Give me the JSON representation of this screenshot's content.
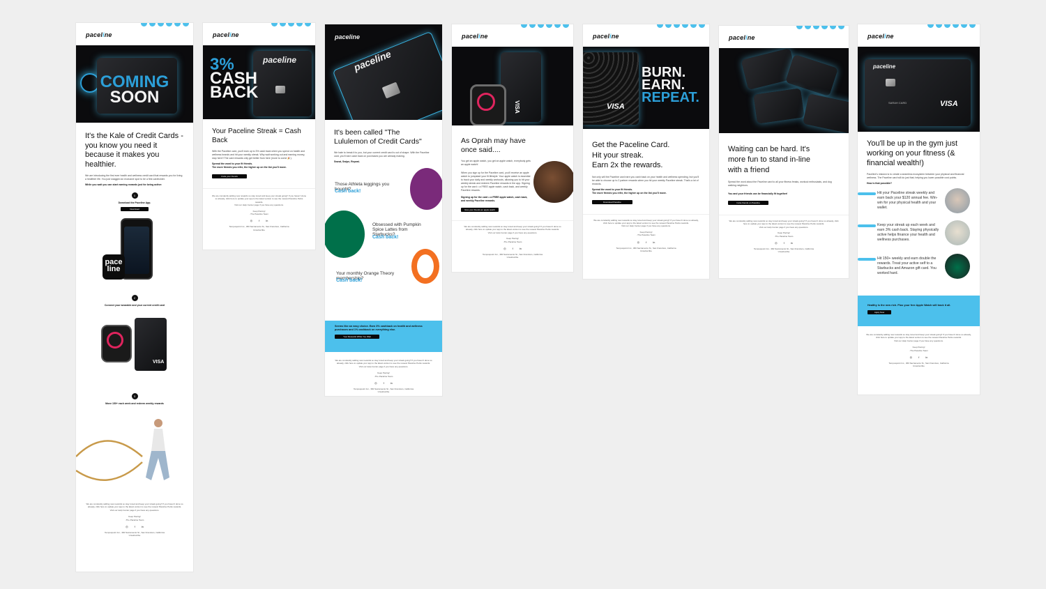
{
  "brand": {
    "name_left": "pacel",
    "name_accent": "i",
    "name_right": "ne",
    "accent_color": "#4cc0ec",
    "dark": "#0b0b0d"
  },
  "footer": {
    "line1": "We are constantly adding new rewards so stay tuned and keep your streak going!! If you haven't done so already, click here to update your app to the latest version to see the newest Paceline Perks rewards.",
    "line2": "Visit our Help Center page if you have any questions.",
    "signoff": "Keep Pacing!",
    "team": "-The Paceline Team",
    "social": [
      "◎",
      "f",
      "in"
    ],
    "address": "Tempuspoint Inc., 360 Sacramento St., San Francisco, California",
    "unsubscribe": "Unsubscribe"
  },
  "email1": {
    "hero_line1": "COMING",
    "hero_line2": "SOON",
    "headline": "It's the Kale of Credit Cards - you know you need it because it makes you healthier.",
    "body": "We are introducing the first ever health and wellness credit card that rewards you for living a healthier life. You just snagged an exclusive spot to be a first cardholder.",
    "bold": "While you wait you can start earning rewards just for being active:",
    "step1_num": "1",
    "step1": "Download the Paceline App.",
    "step1_btn": "Download",
    "app_badge_line1": "pace",
    "app_badge_line2": "line",
    "step2_num": "2",
    "step2": "Connect your wearable and your current credit card",
    "step3_num": "3",
    "step3": "Move 150+ each week and redeem weekly rewards"
  },
  "email2": {
    "hero_3": "3%",
    "hero_cash": "CASH",
    "hero_back": "BACK",
    "card_logo": "paceline",
    "headline": "Your Paceline Streak = Cash Back",
    "body": "With the Paceline card, you'll earn up to 3% cash back when you spend on health and wellness brands and hit your weekly streak. Why wait working out and earning money, stop here!! The card rewards only get better from here (more to come 🎉).",
    "bold1": "Spread the word to your fit friends.",
    "bold2": "The more friends you refer, the higher up on the list you'll move.",
    "cta": "Invite your friends"
  },
  "email3": {
    "card_logo": "paceline",
    "headline": "It's been called \"The Lululemon of Credit Cards\"",
    "body": "We hate to break it to you, but your current credit card is out of shape. With the Paceline card, you'll earn cash back on purchases you are already making.",
    "bold": "Sweat, Swipe, Repeat.",
    "q1": "Those Athleta leggings you bought?",
    "a1": "Cash back!",
    "q2": "Obsessed with Pumpkin Spice Lattes from Starbucks?",
    "a2": "Cash back!",
    "q3": "Your monthly Orange Theory membership?",
    "a3": "Cash back!",
    "banner": "Seems like an easy choice. Earn 3% cashback on health and wellness purchases and 1% cashback on everything else.",
    "banner_cta": "Your Rewards While You Wait"
  },
  "email4": {
    "card_label": "VISA",
    "headline": "As Oprah may have once said....",
    "body1": "You get an apple watch, you get an apple watch, everybody gets an apple watch!",
    "body2": "When you sign up for the Paceline card, you'll receive an apple watch to jumpstart your fit lifestyle. Your apple watch is essential to track your daily and weekly workouts, allowing you to hit your weekly streak and redeem Paceline rewards in the app. Signing up for the card = a FREE apple watch, cash back, and weekly Paceline rewards.",
    "bold": "Signing up for the card = a FREE apple watch, cash back, and weekly Paceline rewards.",
    "cta": "Give your friends an apple watch"
  },
  "email5": {
    "hero_burn": "BURN.",
    "hero_earn": "EARN.",
    "hero_repeat": "REPEAT.",
    "card_label": "VISA",
    "headline1": "Get the Paceline Card.",
    "headline2": "Hit your streak.",
    "headline3": "Earn 2x the rewards.",
    "body": "Not only will the Paceline card earn you cash back on your health and wellness spending, but you'll be able to choose up to 2 partner rewards when you hit your weekly Paceline streak. That's a lot of rewards.",
    "bold1": "Spread the word to your fit friends.",
    "bold2": "The more friends you refer, the higher up on the list you'll move.",
    "cta": "Download Paceline"
  },
  "email6": {
    "headline": "Waiting can be hard. It's more fun to stand in-line with a friend",
    "body": "Spread the word about the Paceline card to all your fitness freaks, workout enthusiasts, and dog walking neighbors.",
    "bold": "You and your friends can be financially fit together!",
    "cta": "Invite friends on Paceline"
  },
  "email7": {
    "card_logo": "paceline",
    "card_name": "SARAH CARD",
    "card_label": "VISA",
    "headline": "You'll be up in the gym just working on your fitness (& financial wealth!)",
    "body": "Paceline's mission is to create a seamless ecosystem between your physical and financial wellness. The Paceline card will do just that; helping you lower possible cost points.",
    "bold": "How is that possible?",
    "item1": "Hit your Paceline streak weekly and earn back your $120 annual fee. Win-win for your physical health and your wallet.",
    "item2": "Keep your streak up each week and earn 3% cash back. Staying physically active helps finance your health and wellness purchases.",
    "item3": "Hit 150+ weekly and earn double the rewards. Treat your active self to a Starbucks and Amazon gift card. You worked hard.",
    "banner": "Healthy is the new rich. Plus your free Apple Watch will track it all.",
    "banner_cta": "Apply Now"
  }
}
